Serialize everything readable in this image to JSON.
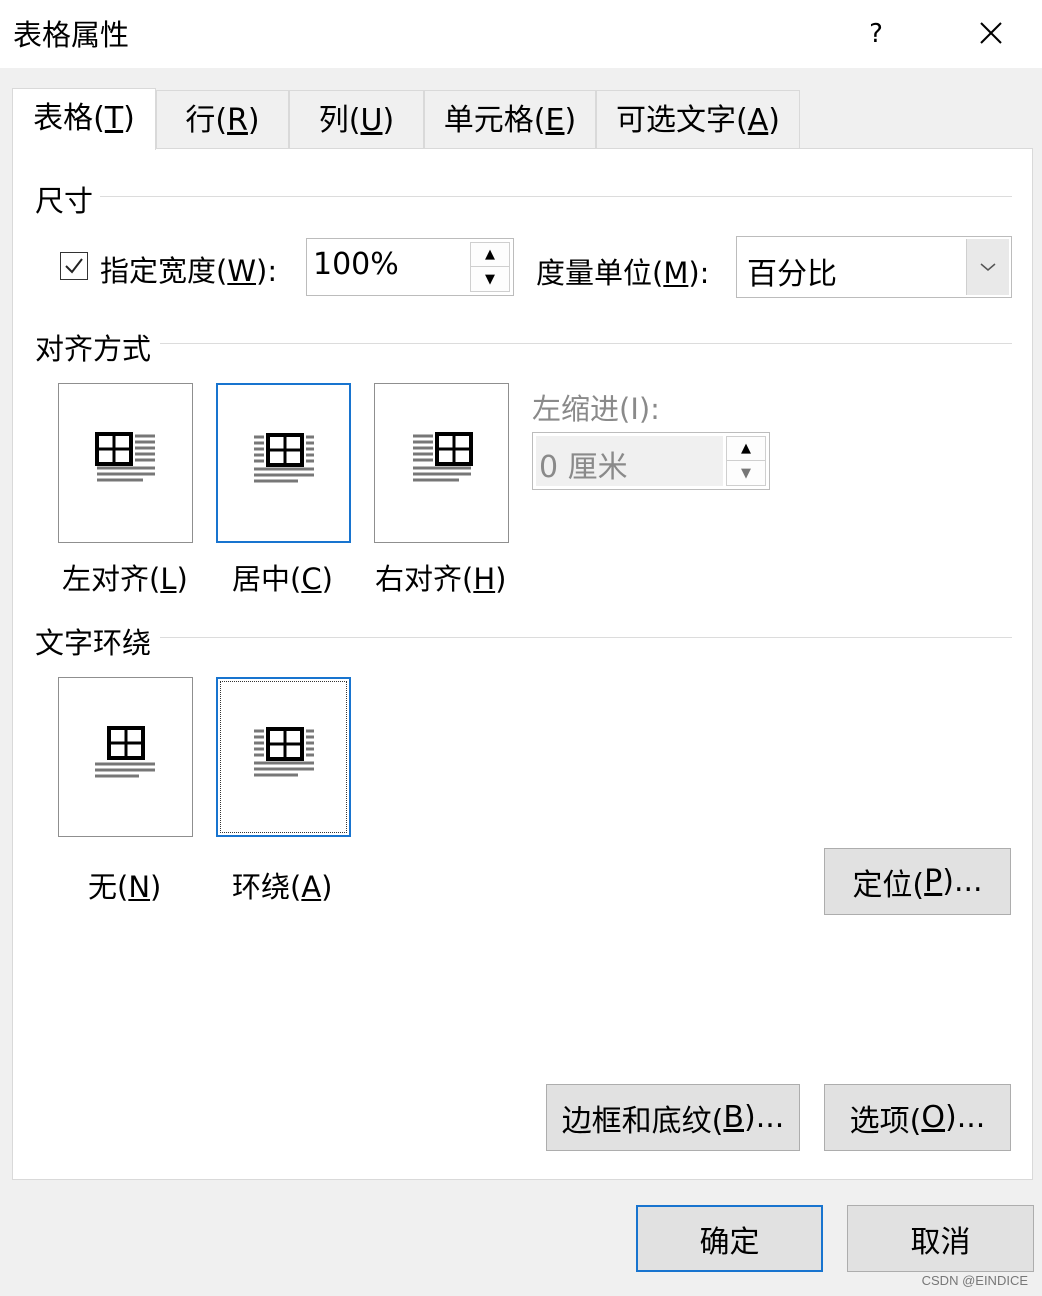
{
  "window": {
    "title": "表格属性",
    "help": "?"
  },
  "tabs": [
    {
      "label": "表格(",
      "key": "T",
      "suffix": ")"
    },
    {
      "label": "行(",
      "key": "R",
      "suffix": ")"
    },
    {
      "label": "列(",
      "key": "U",
      "suffix": ")"
    },
    {
      "label": "单元格(",
      "key": "E",
      "suffix": ")"
    },
    {
      "label": "可选文字(",
      "key": "A",
      "suffix": ")"
    }
  ],
  "size": {
    "group_label": "尺寸",
    "specify_width": {
      "checked": true,
      "label_pre": "指定宽度(",
      "key": "W",
      "label_post": "):"
    },
    "width_value": "100%",
    "measure_label_pre": "度量单位(",
    "measure_key": "M",
    "measure_label_post": "):",
    "measure_value": "百分比"
  },
  "alignment": {
    "group_label": "对齐方式",
    "options": [
      {
        "pre": "左对齐(",
        "key": "L",
        "post": ")"
      },
      {
        "pre": "居中(",
        "key": "C",
        "post": ")"
      },
      {
        "pre": "右对齐(",
        "key": "H",
        "post": ")"
      }
    ],
    "selected": "居中",
    "indent_label": "左缩进(I):",
    "indent_value": "0 厘米"
  },
  "wrapping": {
    "group_label": "文字环绕",
    "options": [
      {
        "pre": "无(",
        "key": "N",
        "post": ")"
      },
      {
        "pre": "环绕(",
        "key": "A",
        "post": ")"
      }
    ],
    "selected": "环绕",
    "position_btn": {
      "pre": "定位(",
      "key": "P",
      "post": ")..."
    }
  },
  "buttons": {
    "borders": {
      "pre": "边框和底纹(",
      "key": "B",
      "post": ")..."
    },
    "options": {
      "pre": "选项(",
      "key": "O",
      "post": ")..."
    },
    "ok": "确定",
    "cancel": "取消"
  },
  "watermark": "CSDN @EINDICE",
  "colors": {
    "accent": "#1874cf",
    "button_bg": "#e1e1e1",
    "dialog_bg": "#f0f0f0"
  }
}
